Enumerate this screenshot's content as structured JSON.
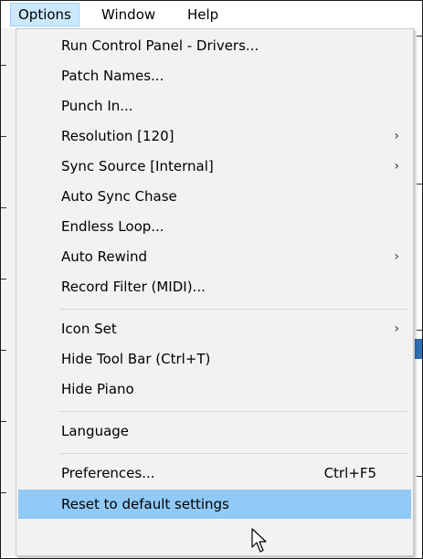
{
  "menubar": {
    "items": [
      {
        "label": "Options"
      },
      {
        "label": "Window"
      },
      {
        "label": "Help"
      }
    ]
  },
  "dropdown": {
    "items": [
      {
        "label": "Run Control Panel - Drivers...",
        "shortcut": "",
        "submenu": false
      },
      {
        "label": "Patch Names...",
        "shortcut": "",
        "submenu": false
      },
      {
        "label": "Punch In...",
        "shortcut": "",
        "submenu": false
      },
      {
        "label": "Resolution [120]",
        "shortcut": "",
        "submenu": true
      },
      {
        "label": "Sync Source [Internal]",
        "shortcut": "",
        "submenu": true
      },
      {
        "label": "Auto Sync Chase",
        "shortcut": "",
        "submenu": false
      },
      {
        "label": "Endless Loop...",
        "shortcut": "",
        "submenu": false
      },
      {
        "label": "Auto Rewind",
        "shortcut": "",
        "submenu": true
      },
      {
        "label": "Record Filter (MIDI)...",
        "shortcut": "",
        "submenu": false
      },
      {
        "label": "Icon Set",
        "shortcut": "",
        "submenu": true
      },
      {
        "label": "Hide Tool Bar  (Ctrl+T)",
        "shortcut": "",
        "submenu": false
      },
      {
        "label": "Hide Piano",
        "shortcut": "",
        "submenu": false
      },
      {
        "label": "Language",
        "shortcut": "",
        "submenu": false
      },
      {
        "label": "Preferences...",
        "shortcut": "Ctrl+F5",
        "submenu": false
      },
      {
        "label": "Reset to default settings",
        "shortcut": "",
        "submenu": false
      }
    ],
    "submenu_glyph": "›",
    "highlighted_item": "Reset to default settings"
  },
  "colors": {
    "menubar_open_bg": "#cce8ff",
    "menubar_open_border": "#99d1ff",
    "menu_bg": "#f2f2f2",
    "highlight_bg": "#91c9f7",
    "separator": "#d7d7d7"
  },
  "icons": {
    "cursor": "mouse-pointer-icon",
    "submenu": "chevron-right-icon"
  }
}
